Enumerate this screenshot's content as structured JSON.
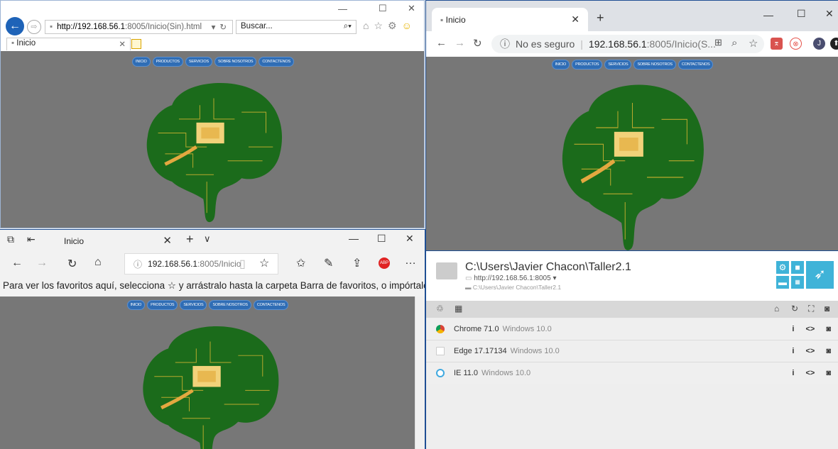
{
  "page_nav": [
    "INICIO",
    "PRODUCTOS",
    "SERVICIOS",
    "SOBRE NOSOTROS",
    "CONTACTENOS"
  ],
  "ie": {
    "address_host": "http://192.168.56.1",
    "address_rest": ":8005/Inicio(Sin).html",
    "search_placeholder": "Buscar...",
    "tab_title": "Inicio"
  },
  "chrome": {
    "tab_title": "Inicio",
    "security": "No es seguro",
    "address_host": "192.168.56.1",
    "address_rest": ":8005/Inicio(S...",
    "profile_initial": "J"
  },
  "edge": {
    "tab_title": "Inicio",
    "address_host": "192.168.56.1",
    "address_rest": ":8005/Inicio",
    "favorites_hint": "Para ver los favoritos aquí, selecciona ☆ y arrástralo hasta la carpeta Barra de favoritos, o impórtalos"
  },
  "browsersync": {
    "project_path": "C:\\Users\\Javier Chacon\\Taller2.1",
    "url": "http://192.168.56.1:8005",
    "dir": "C:\\Users\\Javier Chacon\\Taller2.1",
    "browsers": [
      {
        "name": "Chrome 71.0",
        "os": "Windows 10.0",
        "icon": "chrome-icon",
        "color": "#e8453c"
      },
      {
        "name": "Edge 17.17134",
        "os": "Windows 10.0",
        "icon": "edge-icon",
        "color": "#ffffff"
      },
      {
        "name": "IE 11.0",
        "os": "Windows 10.0",
        "icon": "ie-icon",
        "color": "#3fa9e0"
      }
    ]
  }
}
